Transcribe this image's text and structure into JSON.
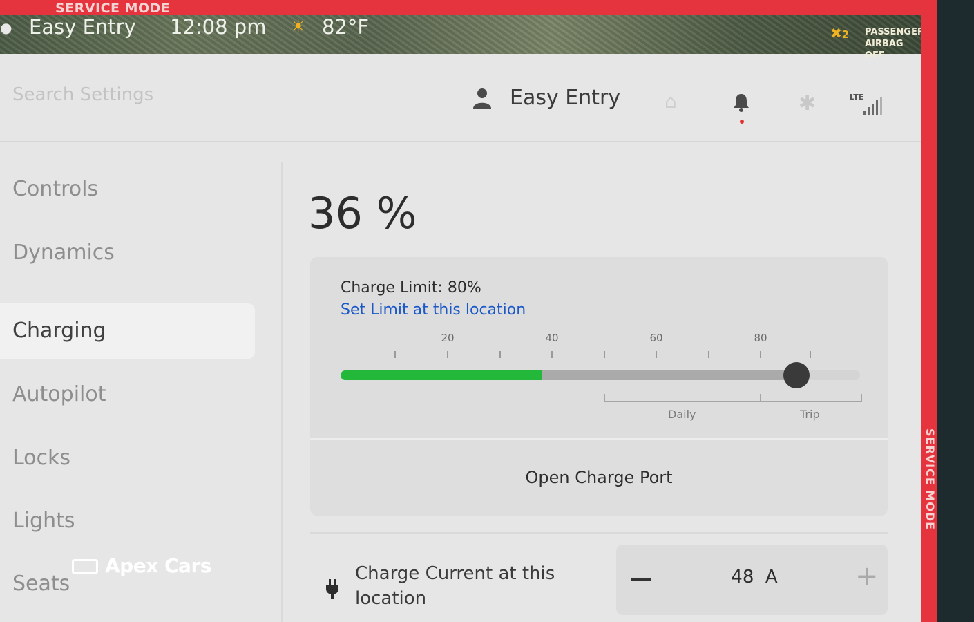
{
  "frame": {
    "top_label": "SERVICE MODE",
    "side_label": "SERVICE MODE",
    "color": "#e5343d"
  },
  "status_bar": {
    "profile": "Easy Entry",
    "time": "12:08 pm",
    "weather_icon": "sun-icon",
    "temperature": "82°F",
    "airbag_icon_text": "2",
    "airbag_line1": "PASSENGER",
    "airbag_line2": "AIRBAG OFF"
  },
  "top_bar": {
    "search_placeholder": "Search Settings",
    "user_name": "Easy Entry",
    "icons": [
      "user-icon",
      "garage-icon",
      "bell-icon",
      "bluetooth-icon",
      "cell-signal-icon"
    ],
    "lte_label": "LTE"
  },
  "sidebar": {
    "items": [
      {
        "label": "Controls",
        "active": false
      },
      {
        "label": "Dynamics",
        "active": false
      },
      {
        "label": "Charging",
        "active": true
      },
      {
        "label": "Autopilot",
        "active": false
      },
      {
        "label": "Locks",
        "active": false
      },
      {
        "label": "Lights",
        "active": false
      },
      {
        "label": "Seats",
        "active": false
      }
    ]
  },
  "watermark": "Apex Cars",
  "charging": {
    "battery_percent": "36 %",
    "battery_level": 36,
    "charge_limit_text": "Charge Limit: 80%",
    "charge_limit_value": 80,
    "set_limit_link": "Set Limit at this location",
    "tick_labels": [
      "20",
      "40",
      "60",
      "80"
    ],
    "daily_label": "Daily",
    "trip_label": "Trip",
    "open_port_button": "Open Charge Port",
    "charge_current_label": "Charge Current at this location",
    "charge_current_value": "48",
    "charge_current_unit": "A",
    "colors": {
      "battery_fill": "#23b83a",
      "link": "#1b58c8"
    }
  }
}
